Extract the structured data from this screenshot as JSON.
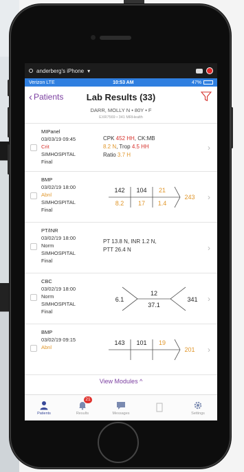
{
  "mirror_bar": {
    "device_name": "anderberg's iPhone"
  },
  "status_bar": {
    "carrier": "Verizon LTE",
    "time": "10:53 AM",
    "battery": "47%"
  },
  "nav": {
    "back_label": "Patients",
    "title": "Lab Results (33)"
  },
  "patient": {
    "name_line": "DARR, MOLLY N • 80Y • F",
    "sub_line": "EXR7569 • 341 MRHealth"
  },
  "results": [
    {
      "name": "MIPanel",
      "datetime": "03/03/19 09:45",
      "status": "Crit",
      "status_class": "crit",
      "facility": "SIMHOSPITAL",
      "state": "Final",
      "line1_a": "CPK ",
      "line1_b": "452 HH",
      "line1_c": ", CK:MB",
      "line2_a": "8.2 N",
      "line2_b": ", Trop ",
      "line2_c": "4.5 HH",
      "line3_a": "Ratio ",
      "line3_b": "3.7 H"
    },
    {
      "name": "BMP",
      "datetime": "03/02/19 18:00",
      "status": "Abnl",
      "status_class": "abnl",
      "facility": "SIMHOSPITAL",
      "state": "Final",
      "fish": {
        "na": "142",
        "cl": "104",
        "bun": "21",
        "k": "8.2",
        "co2": "17",
        "cr": "1.4",
        "glu": "243"
      }
    },
    {
      "name": "PT/INR",
      "datetime": "03/02/19 18:00",
      "status": "Norm",
      "status_class": "norm",
      "facility": "SIMHOSPITAL",
      "state": "Final",
      "line1": "PT 13.8 N, INR 1.2 N,",
      "line2": "PTT 26.4 N"
    },
    {
      "name": "CBC",
      "datetime": "03/02/19 18:00",
      "status": "Norm",
      "status_class": "norm",
      "facility": "SIMHOSPITAL",
      "state": "Final",
      "fish": {
        "wbc": "6.1",
        "hgb": "12",
        "hct": "37.1",
        "plt": "341"
      }
    },
    {
      "name": "BMP",
      "datetime": "03/02/19 09:15",
      "status": "Abnl",
      "status_class": "abnl",
      "facility": "",
      "state": "",
      "fish": {
        "na": "143",
        "cl": "101",
        "bun": "19",
        "glu": "201"
      }
    }
  ],
  "view_modules": "View Modules ^",
  "tabs": [
    {
      "label": "Patients",
      "icon": "person-icon"
    },
    {
      "label": "Results",
      "icon": "bell-icon",
      "badge": "21"
    },
    {
      "label": "Messages",
      "icon": "chat-icon"
    },
    {
      "label": "",
      "icon": "document-icon"
    },
    {
      "label": "Settings",
      "icon": "gear-icon"
    }
  ],
  "colors": {
    "accent": "#7b3fa0",
    "status_bar": "#2f7fe0",
    "critical": "#d6302b",
    "abnormal": "#e0962a"
  }
}
